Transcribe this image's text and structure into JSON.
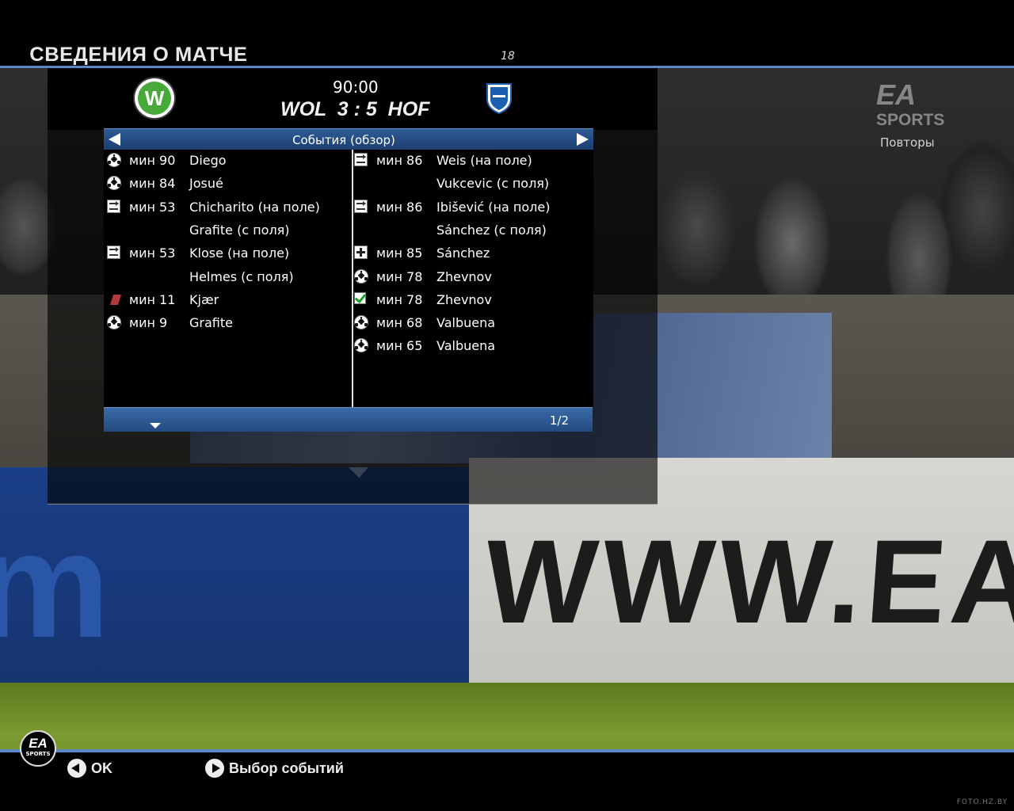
{
  "header": {
    "title": "СВЕДЕНИЯ О МАТЧЕ",
    "page_number": "18"
  },
  "match": {
    "time": "90:00",
    "score_line": "WOL  3 : 5  HOF",
    "home_badge_letter": "W",
    "home_color": "#46a93a",
    "away_color": "#1c5fb0"
  },
  "events": {
    "title": "События (обзор)",
    "pager": "1/2",
    "home": [
      {
        "icon": "ball-icon",
        "minute": "мин 90",
        "name": "Diego"
      },
      {
        "icon": "ball-icon",
        "minute": "мин 84",
        "name": "Josué"
      },
      {
        "icon": "substitution-icon",
        "minute": "мин 53",
        "name": "Chicharito (на поле)"
      },
      {
        "icon": "",
        "minute": "",
        "name": "Grafite (с поля)"
      },
      {
        "icon": "substitution-icon",
        "minute": "мин 53",
        "name": "Klose (на поле)"
      },
      {
        "icon": "",
        "minute": "",
        "name": "Helmes (с поля)"
      },
      {
        "icon": "red-card-icon",
        "minute": "мин 11",
        "name": "Kjær"
      },
      {
        "icon": "ball-icon",
        "minute": "мин 9",
        "name": "Grafite"
      }
    ],
    "away": [
      {
        "icon": "substitution-icon",
        "minute": "мин 86",
        "name": "Weis (на поле)"
      },
      {
        "icon": "",
        "minute": "",
        "name": "Vukcevic (с поля)"
      },
      {
        "icon": "substitution-icon",
        "minute": "мин 86",
        "name": "Ibišević (на поле)"
      },
      {
        "icon": "",
        "minute": "",
        "name": "Sánchez (с поля)"
      },
      {
        "icon": "injury-icon",
        "minute": "мин 85",
        "name": "Sánchez"
      },
      {
        "icon": "ball-icon",
        "minute": "мин 78",
        "name": "Zhevnov"
      },
      {
        "icon": "check-icon",
        "minute": "мин 78",
        "name": "Zhevnov"
      },
      {
        "icon": "ball-icon",
        "minute": "мин 68",
        "name": "Valbuena"
      },
      {
        "icon": "ball-icon",
        "minute": "мин 65",
        "name": "Valbuena"
      }
    ]
  },
  "side": {
    "ea_logo": "EA",
    "ea_logo_sub": "SPORTS",
    "replays": "Повторы"
  },
  "background": {
    "ad_text": "WWW.EAS",
    "ad_letter": "m"
  },
  "footer": {
    "ea_circle": "EA",
    "ea_circle_sub": "SPORTS",
    "ok_label": "OK",
    "select_label": "Выбор событий"
  },
  "watermark": "FOTO.HZ.BY"
}
